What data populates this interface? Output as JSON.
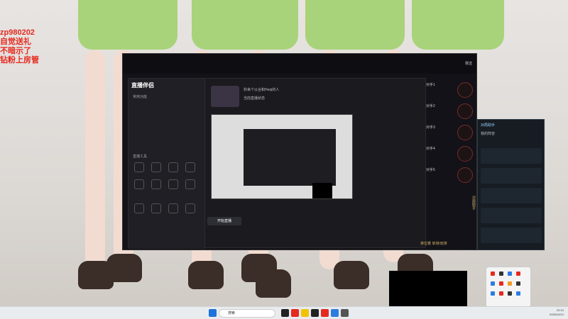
{
  "overlay": {
    "lines": [
      "zp980202",
      "自觉送礼",
      "不暗示了",
      "钻粉上房管"
    ]
  },
  "app": {
    "logo": "直播伴侣",
    "section_common": "常用功能",
    "section_tools": "直播工具",
    "start_button": "开始直播",
    "streamer": "秒来个以合和Heqi的人",
    "status": "当前直播状态"
  },
  "game": {
    "opponents": [
      "对手1",
      "对手2",
      "对手3",
      "对手4",
      "对手5"
    ],
    "side_label": "对局助手",
    "mode": "排位赛 单排/双排",
    "top_right": "赛选"
  },
  "team_panel": {
    "title": "对局助手",
    "tab": "我的阵容"
  },
  "taskbar": {
    "search_placeholder": "搜索",
    "time": "20:10",
    "date": "2025/10/12"
  },
  "colors": {
    "accent_red": "#e52a1e",
    "gold": "#d6b46a",
    "orange_badge": "#f29b24"
  }
}
